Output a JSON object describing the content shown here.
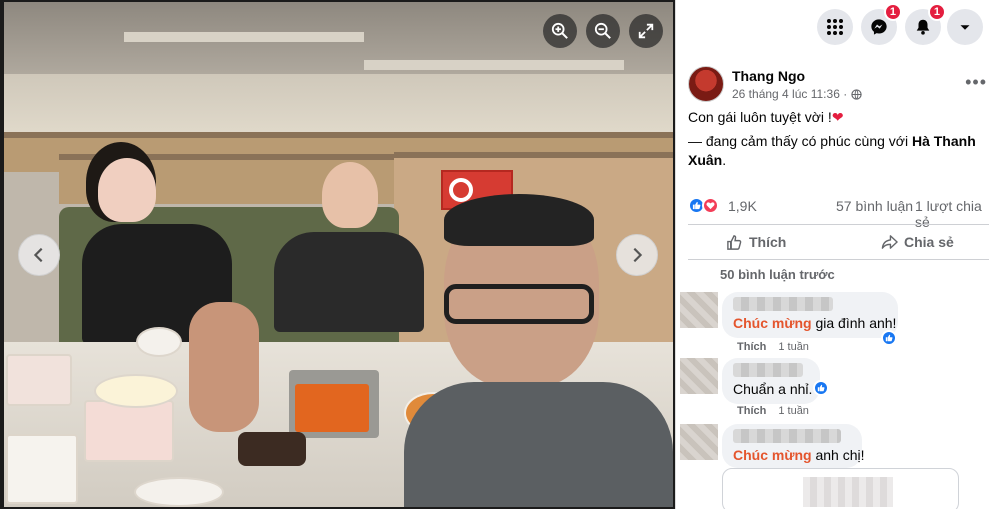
{
  "viewer": {
    "controls": [
      {
        "icon": "zoom-in-icon"
      },
      {
        "icon": "zoom-out-icon"
      },
      {
        "icon": "fullscreen-icon"
      }
    ],
    "prev_icon": "chevron-left-icon",
    "next_icon": "chevron-right-icon",
    "photo_description_icon": "photo"
  },
  "topbar": {
    "buttons": [
      {
        "icon": "menu-grid-icon",
        "badge": ""
      },
      {
        "icon": "messenger-icon",
        "badge": "1"
      },
      {
        "icon": "notifications-bell-icon",
        "badge": "1"
      },
      {
        "icon": "account-caret-icon",
        "badge": ""
      }
    ]
  },
  "post": {
    "author": "Thang Ngo",
    "timestamp": "26 tháng 4 lúc 11:36 ·",
    "privacy_icon": "globe-icon",
    "caption_line1": "Con gái luôn tuyệt vời !",
    "caption_heart": "❤",
    "caption_line2_prefix": "— đang cảm thấy có phúc cùng với ",
    "caption_tag": "Hà Thanh Xuân",
    "caption_line2_suffix": ".",
    "reactions_count": "1,9K",
    "comments_count": "57 bình luận",
    "shares_count": "1 lượt chia sẻ",
    "like_label": "Thích",
    "share_label": "Chia sẻ"
  },
  "comments": {
    "previous_label": "50 bình luận trước",
    "items": [
      {
        "highlight": "Chúc mừng",
        "text": " gia đình anh!",
        "like_label": "Thích",
        "time": "1 tuần",
        "has_reaction": true
      },
      {
        "highlight": "",
        "text": "Chuẩn a nhỉ.",
        "like_label": "Thích",
        "time": "1 tuần",
        "has_reaction": true
      },
      {
        "highlight": "Chúc mừng",
        "text": " anh chị!",
        "like_label": "",
        "time": "",
        "has_reaction": false
      }
    ]
  },
  "colors": {
    "facebook_blue": "#1877f2",
    "love_red": "#f33e58",
    "badge_red": "#e41e3f",
    "highlight_orange": "#e4552d",
    "secondary_text": "#65676b"
  }
}
